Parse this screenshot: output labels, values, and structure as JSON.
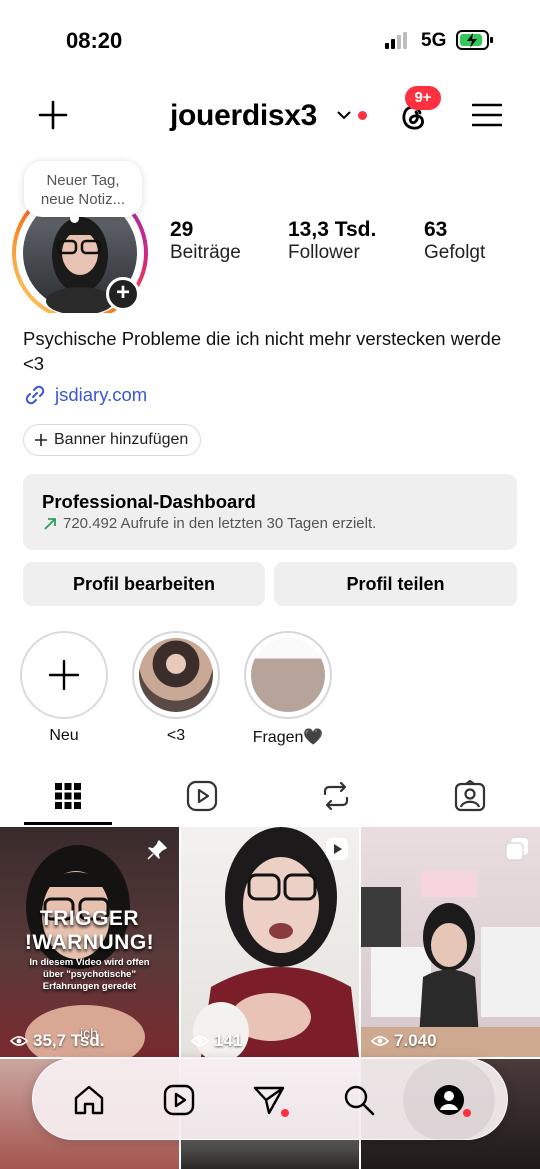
{
  "status_bar": {
    "time": "08:20",
    "network": "5G"
  },
  "header": {
    "username": "jouerdisx3",
    "threads_badge": "9+"
  },
  "profile": {
    "note": "Neuer Tag, neue Notiz...",
    "stats": [
      {
        "value": "29",
        "label": "Beiträge"
      },
      {
        "value": "13,3 Tsd.",
        "label": "Follower"
      },
      {
        "value": "63",
        "label": "Gefolgt"
      }
    ],
    "bio": "Psychische Probleme die ich nicht mehr verstecken werde <3",
    "link": "jsdiary.com",
    "banner_label": "Banner hinzufügen"
  },
  "dashboard": {
    "title": "Professional-Dashboard",
    "subtitle": "720.492 Aufrufe in den letzten 30 Tagen erzielt."
  },
  "buttons": {
    "edit": "Profil bearbeiten",
    "share": "Profil teilen"
  },
  "highlights": [
    {
      "label": "Neu"
    },
    {
      "label": "<3"
    },
    {
      "label": "Fragen🖤"
    }
  ],
  "tabs": [
    "posts-grid",
    "reels",
    "reposts",
    "tagged"
  ],
  "grid": [
    {
      "overlay_title_1": "TRIGGER",
      "overlay_title_2": "!WARNUNG!",
      "overlay_sub": "In diesem Video wird offen über \"psychotische\" Erfahrungen geredet",
      "caption": "ich",
      "views": "35,7 Tsd.",
      "badge": "pin-icon"
    },
    {
      "views": "141",
      "badge": "reel-icon"
    },
    {
      "views": "7.040",
      "badge": "carousel-icon"
    }
  ],
  "colors": {
    "accent_red": "#ff3040",
    "link_blue": "#3a57d6",
    "button_gray": "#efefef",
    "trend_green": "#2e9e5b"
  }
}
